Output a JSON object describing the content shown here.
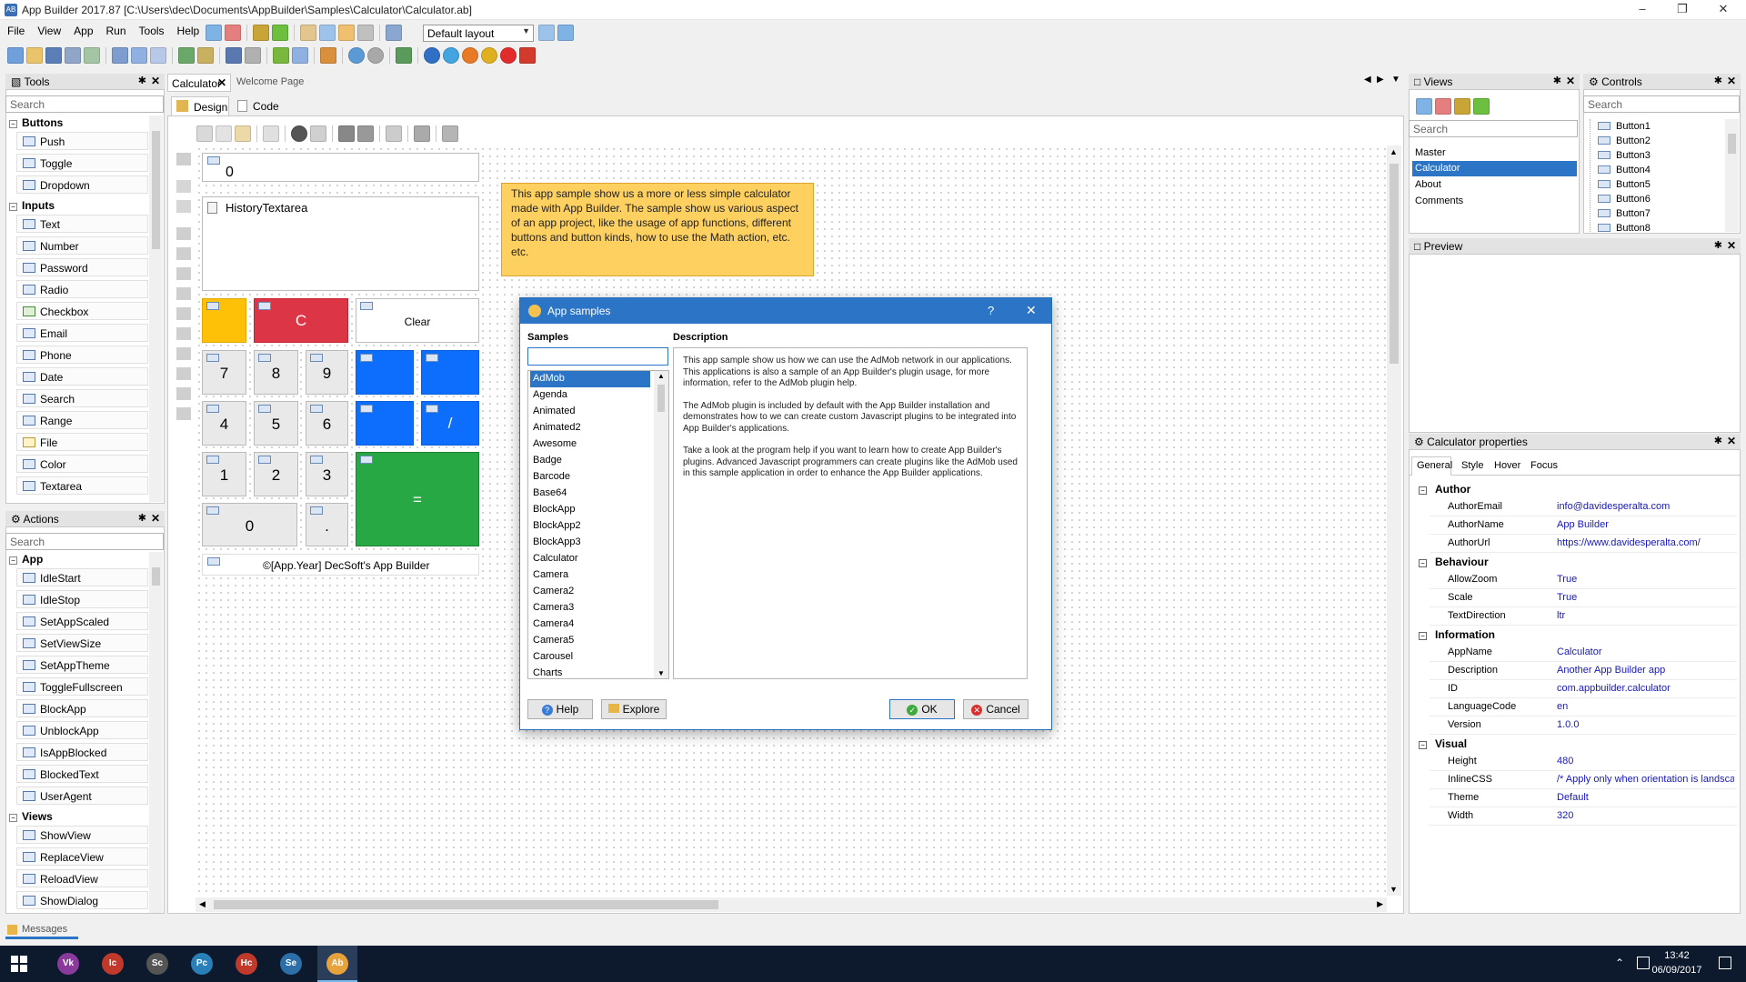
{
  "window": {
    "title": "App Builder 2017.87 [C:\\Users\\dec\\Documents\\AppBuilder\\Samples\\Calculator\\Calculator.ab]"
  },
  "menu": [
    "File",
    "View",
    "App",
    "Run",
    "Tools",
    "Help"
  ],
  "layout_combo": "Default layout",
  "tools_panel": {
    "title": "Tools",
    "search": "Search",
    "groups": [
      {
        "name": "Buttons",
        "items": [
          "Push",
          "Toggle",
          "Dropdown"
        ]
      },
      {
        "name": "Inputs",
        "items": [
          "Text",
          "Number",
          "Password",
          "Radio",
          "Checkbox",
          "Email",
          "Phone",
          "Date",
          "Search",
          "Range",
          "File",
          "Color",
          "Textarea"
        ]
      }
    ]
  },
  "actions_panel": {
    "title": "Actions",
    "search": "Search",
    "groups": [
      {
        "name": "App",
        "items": [
          "IdleStart",
          "IdleStop",
          "SetAppScaled",
          "SetViewSize",
          "SetAppTheme",
          "ToggleFullscreen",
          "BlockApp",
          "UnblockApp",
          "IsAppBlocked",
          "BlockedText",
          "UserAgent"
        ]
      },
      {
        "name": "Views",
        "items": [
          "ShowView",
          "ReplaceView",
          "ReloadView",
          "ShowDialog"
        ]
      }
    ]
  },
  "messages": "Messages",
  "doc_tabs": [
    "Calculator",
    "Welcome Page"
  ],
  "design_tabs": [
    "Design",
    "Code"
  ],
  "calculator": {
    "display": "0",
    "history": "HistoryTextarea",
    "clear_label": "C",
    "clear_text": "Clear",
    "digits": {
      "seven": "7",
      "eight": "8",
      "nine": "9",
      "four": "4",
      "five": "5",
      "six": "6",
      "one": "1",
      "two": "2",
      "three": "3",
      "zero": "0",
      "dot": "."
    },
    "divide": "/",
    "equals": "=",
    "footer": "©[App.Year] DecSoft's App Builder"
  },
  "note": "This app sample show us a more or less simple calculator made with App Builder. The sample show us various aspect of an app project, like the usage of app functions, different buttons and button kinds, how to use the Math action, etc. etc.",
  "dialog": {
    "title": "App samples",
    "help_glyph": "?",
    "samples_label": "Samples",
    "description_label": "Description",
    "samples": [
      "AdMob",
      "Agenda",
      "Animated",
      "Animated2",
      "Awesome",
      "Badge",
      "Barcode",
      "Base64",
      "BlockApp",
      "BlockApp2",
      "BlockApp3",
      "Calculator",
      "Camera",
      "Camera2",
      "Camera3",
      "Camera4",
      "Camera5",
      "Carousel",
      "Charts"
    ],
    "selected": "AdMob",
    "description_1": "This app sample show us how we can use the AdMob network in our applications. This applications is also a sample of an App Builder's plugin usage, for more information, refer to the AdMob plugin help.",
    "description_2": "The AdMob plugin is included by default with the App Builder installation and demonstrates how to we can create custom Javascript plugins to be integrated into App Builder's applications.",
    "description_3": "Take a look at the program help if you want to learn how to create App Builder's plugins. Advanced Javascript programmers can create plugins like the AdMob used in this sample application in order to enhance the App Builder applications.",
    "help_btn": "Help",
    "explore_btn": "Explore",
    "ok_btn": "OK",
    "cancel_btn": "Cancel"
  },
  "views_panel": {
    "title": "Views",
    "search": "Search",
    "items": [
      "Master",
      "Calculator",
      "About",
      "Comments"
    ],
    "selected": "Calculator"
  },
  "controls_panel": {
    "title": "Controls",
    "search": "Search",
    "items": [
      "Button1",
      "Button2",
      "Button3",
      "Button4",
      "Button5",
      "Button6",
      "Button7",
      "Button8"
    ]
  },
  "preview_panel": {
    "title": "Preview"
  },
  "properties_panel": {
    "title": "Calculator properties",
    "tabs": [
      "General",
      "Style",
      "Hover",
      "Focus"
    ],
    "groups": [
      {
        "name": "Author",
        "rows": [
          [
            "AuthorEmail",
            "info@davidesperalta.com"
          ],
          [
            "AuthorName",
            "App Builder"
          ],
          [
            "AuthorUrl",
            "https://www.davidesperalta.com/"
          ]
        ]
      },
      {
        "name": "Behaviour",
        "rows": [
          [
            "AllowZoom",
            "True"
          ],
          [
            "Scale",
            "True"
          ],
          [
            "TextDirection",
            "ltr"
          ]
        ]
      },
      {
        "name": "Information",
        "rows": [
          [
            "AppName",
            "Calculator"
          ],
          [
            "Description",
            "Another App Builder app"
          ],
          [
            "ID",
            "com.appbuilder.calculator"
          ],
          [
            "LanguageCode",
            "en"
          ],
          [
            "Version",
            "1.0.0"
          ]
        ]
      },
      {
        "name": "Visual",
        "rows": [
          [
            "Height",
            "480"
          ],
          [
            "InlineCSS",
            "/* Apply only when orientation is landsca"
          ],
          [
            "Theme",
            "Default"
          ],
          [
            "Width",
            "320"
          ]
        ]
      }
    ]
  },
  "taskbar": {
    "apps": [
      "Vk",
      "Ic",
      "Sc",
      "Pc",
      "Hc",
      "Se",
      "Ab"
    ],
    "time": "13:42",
    "date": "06/09/2017"
  },
  "colors": {
    "accent": "#2b74c6",
    "note": "#fed060",
    "calc_red": "#dc3545",
    "calc_blue": "#0d6efd",
    "calc_green": "#28a745",
    "calc_orange": "#ffc107"
  }
}
